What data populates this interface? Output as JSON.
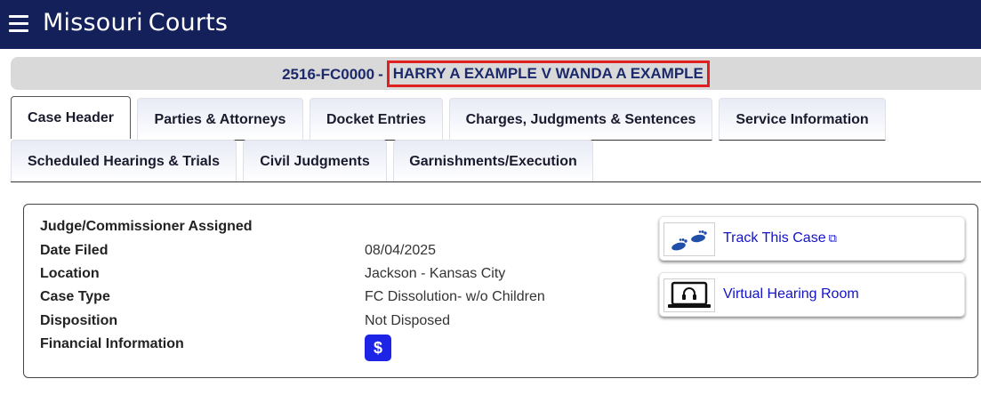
{
  "header": {
    "brand_part1": "Missouri",
    "brand_part2": "Courts",
    "menu_icon": "hamburger-icon"
  },
  "case": {
    "number": "2516-FC0000",
    "separator": "-",
    "style": "HARRY A EXAMPLE V WANDA A EXAMPLE",
    "highlight_color": "#e02020"
  },
  "tabs": [
    {
      "label": "Case Header",
      "active": true
    },
    {
      "label": "Parties & Attorneys"
    },
    {
      "label": "Docket Entries"
    },
    {
      "label": "Charges, Judgments & Sentences"
    },
    {
      "label": "Service Information"
    },
    {
      "label": "Scheduled Hearings & Trials"
    },
    {
      "label": "Civil Judgments"
    },
    {
      "label": "Garnishments/Execution"
    }
  ],
  "details": {
    "judge_label": "Judge/Commissioner Assigned",
    "date_filed_label": "Date Filed",
    "date_filed_value": "08/04/2025",
    "location_label": "Location",
    "location_value": "Jackson - Kansas City",
    "case_type_label": "Case Type",
    "case_type_value": "FC Dissolution- w/o Children",
    "disposition_label": "Disposition",
    "disposition_value": "Not Disposed",
    "financial_label": "Financial Information",
    "financial_button": "$"
  },
  "actions": {
    "track_label": "Track This Case",
    "track_icon": "footprints-icon",
    "track_external_icon": "external-link-icon",
    "virtual_label": "Virtual Hearing Room",
    "virtual_icon": "laptop-headset-icon"
  },
  "colors": {
    "topbar": "#14205a",
    "link": "#1212c8",
    "dollar_button": "#1e24e6"
  }
}
